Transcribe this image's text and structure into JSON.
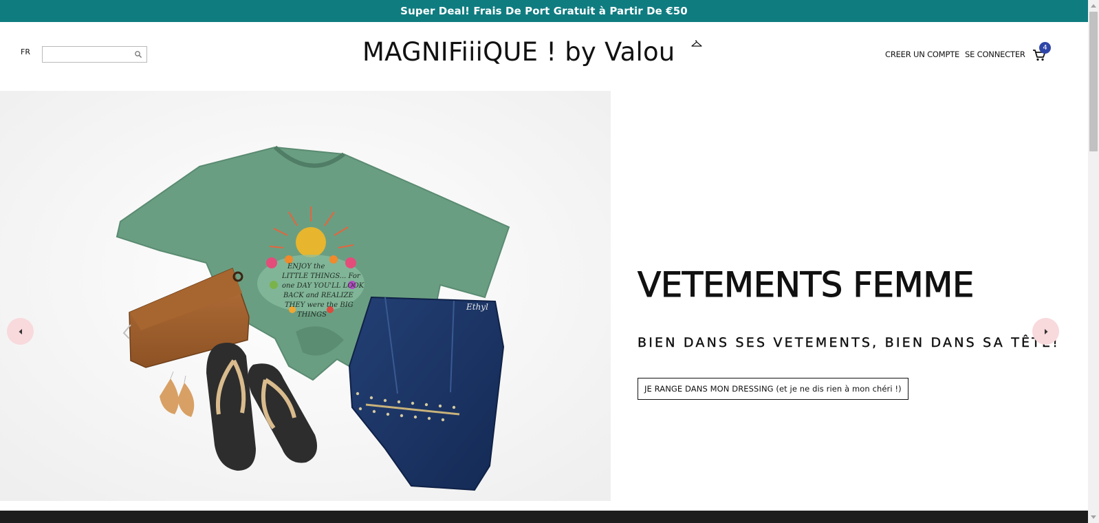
{
  "promo": {
    "text": "Super Deal! Frais De Port Gratuit à Partir De €50"
  },
  "header": {
    "language": "FR",
    "search": {
      "placeholder": "",
      "value": ""
    },
    "logo": "MAGNIFiiiQUE ! by Valou",
    "nav": {
      "create_account": "CREER UN COMPTE",
      "login": "SE CONNECTER"
    },
    "cart_count": "4"
  },
  "hero": {
    "title": "VETEMENTS FEMME",
    "subtitle": "BIEN DANS SES VETEMENTS, BIEN DANS SA TÊTE!",
    "button": "JE RANGE DANS MON DRESSING (et je ne dis rien à mon chéri !)",
    "shirt_print": [
      "ENJOY the",
      "LITTLE THINGS... For",
      "one DAY YOU'LL LOOK",
      "BACK and REALIZE",
      "THEY were the BIG",
      "THINGS"
    ],
    "jeans_label": "Ethyl"
  },
  "colors": {
    "promo_bg": "#0f7c80",
    "badge": "#2f46a8",
    "arrow_bg": "#f8d9dc"
  }
}
